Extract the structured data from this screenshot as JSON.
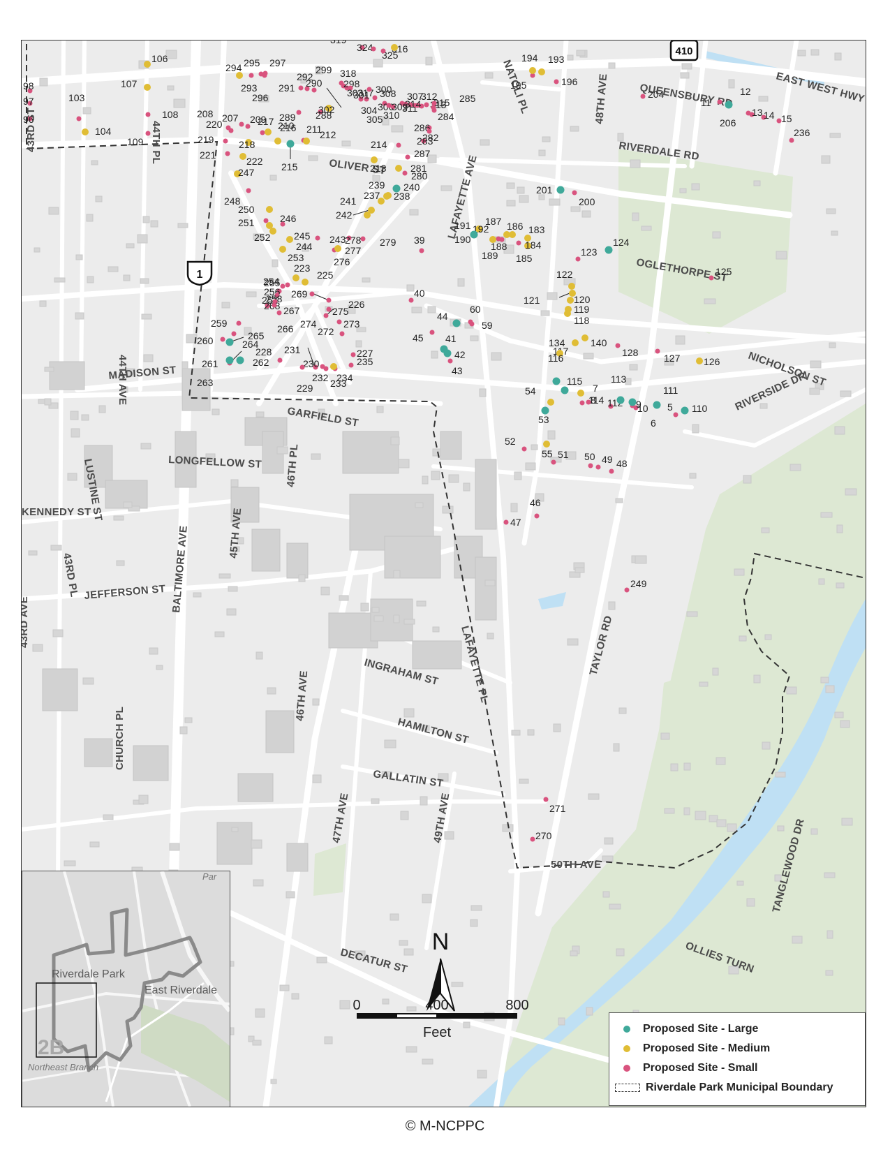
{
  "legend": {
    "large": "Proposed Site - Large",
    "medium": "Proposed Site - Medium",
    "small": "Proposed Site - Small",
    "boundary": "Riverdale Park Municipal Boundary"
  },
  "colors": {
    "large": "#3fa99a",
    "medium": "#e0bd35",
    "small": "#d9537e",
    "road": "#ffffff",
    "park": "#dde8d3",
    "water": "#bfe0f4",
    "background": "#ececec"
  },
  "scale_bar": {
    "ticks": [
      "0",
      "400",
      "800"
    ],
    "unit": "Feet"
  },
  "north_arrow": "N",
  "copyright": "© M-NCPPC",
  "shields": {
    "us_route": "1",
    "state_route": "410"
  },
  "inset": {
    "labels": [
      "Riverdale Park",
      "East Riverdale",
      "Northeast Branch",
      "Par"
    ],
    "area_code": "2B"
  },
  "streets": [
    "43RD ST",
    "44TH PL",
    "NATOLI PL",
    "EAST WEST HWY",
    "QUEENSBURY RD",
    "48TH AVE",
    "RIVERDALE RD",
    "OLIVER ST",
    "LAFAYETTE AVE",
    "OGLETHORPE ST",
    "44TH AVE",
    "MADISON ST",
    "GARFIELD ST",
    "NICHOLSON ST",
    "RIVERSIDE DR",
    "LONGFELLOW ST",
    "LUSTINE ST",
    "46TH PL",
    "KENNEDY ST",
    "43RD PL",
    "45TH AVE",
    "BALTIMORE AVE",
    "JEFFERSON ST",
    "43RD AVE",
    "INGRAHAM ST",
    "LAFAYETTE PL",
    "TAYLOR RD",
    "HAMILTON ST",
    "46TH AVE",
    "CHURCH PL",
    "GALLATIN ST",
    "47TH AVE",
    "49TH AVE",
    "50TH AVE",
    "TANGLEWOOD DR",
    "OLLIES TURN",
    "DECATUR ST"
  ],
  "sites": {
    "large": [
      "12",
      "215",
      "240",
      "201",
      "124",
      "191",
      "44",
      "41",
      "42",
      "264",
      "261",
      "262",
      "116",
      "115",
      "113",
      "9",
      "5",
      "110",
      "53"
    ],
    "medium": [
      "106",
      "107",
      "104",
      "294",
      "319",
      "217",
      "216",
      "211",
      "218",
      "222",
      "247",
      "250",
      "251",
      "252",
      "244",
      "253",
      "223",
      "225",
      "213",
      "281",
      "239",
      "237",
      "241",
      "242",
      "238",
      "277",
      "190",
      "187",
      "186",
      "183",
      "184",
      "192",
      "194",
      "193",
      "122",
      "121",
      "120",
      "119",
      "118",
      "117",
      "134",
      "140",
      "126",
      "54",
      "7",
      "55",
      "233",
      "302"
    ],
    "small": [
      "98",
      "97",
      "96",
      "103",
      "108",
      "109",
      "220",
      "219",
      "221",
      "208",
      "207",
      "209",
      "210",
      "295",
      "293",
      "296",
      "297",
      "291",
      "292",
      "290",
      "299",
      "318",
      "298",
      "303",
      "317",
      "300",
      "324",
      "325",
      "316",
      "301",
      "308",
      "306",
      "304",
      "305",
      "288",
      "289",
      "310",
      "309",
      "311",
      "307",
      "312",
      "314",
      "313",
      "315",
      "285",
      "284",
      "286",
      "282",
      "283",
      "214",
      "287",
      "212",
      "248",
      "246",
      "245",
      "243",
      "278",
      "279",
      "276",
      "280",
      "254",
      "255",
      "256",
      "257",
      "258",
      "259",
      "260",
      "265",
      "268",
      "267",
      "266",
      "269",
      "226",
      "275",
      "273",
      "274",
      "272",
      "231",
      "230",
      "228",
      "229",
      "232",
      "234",
      "235",
      "227",
      "263",
      "39",
      "40",
      "60",
      "59",
      "45",
      "43",
      "195",
      "196",
      "204",
      "11",
      "13",
      "14",
      "15",
      "206",
      "236",
      "200",
      "123",
      "125",
      "188",
      "189",
      "185",
      "128",
      "127",
      "114",
      "111",
      "112",
      "8",
      "10",
      "6",
      "52",
      "51",
      "50",
      "49",
      "48",
      "46",
      "47",
      "249",
      "271",
      "270"
    ]
  }
}
